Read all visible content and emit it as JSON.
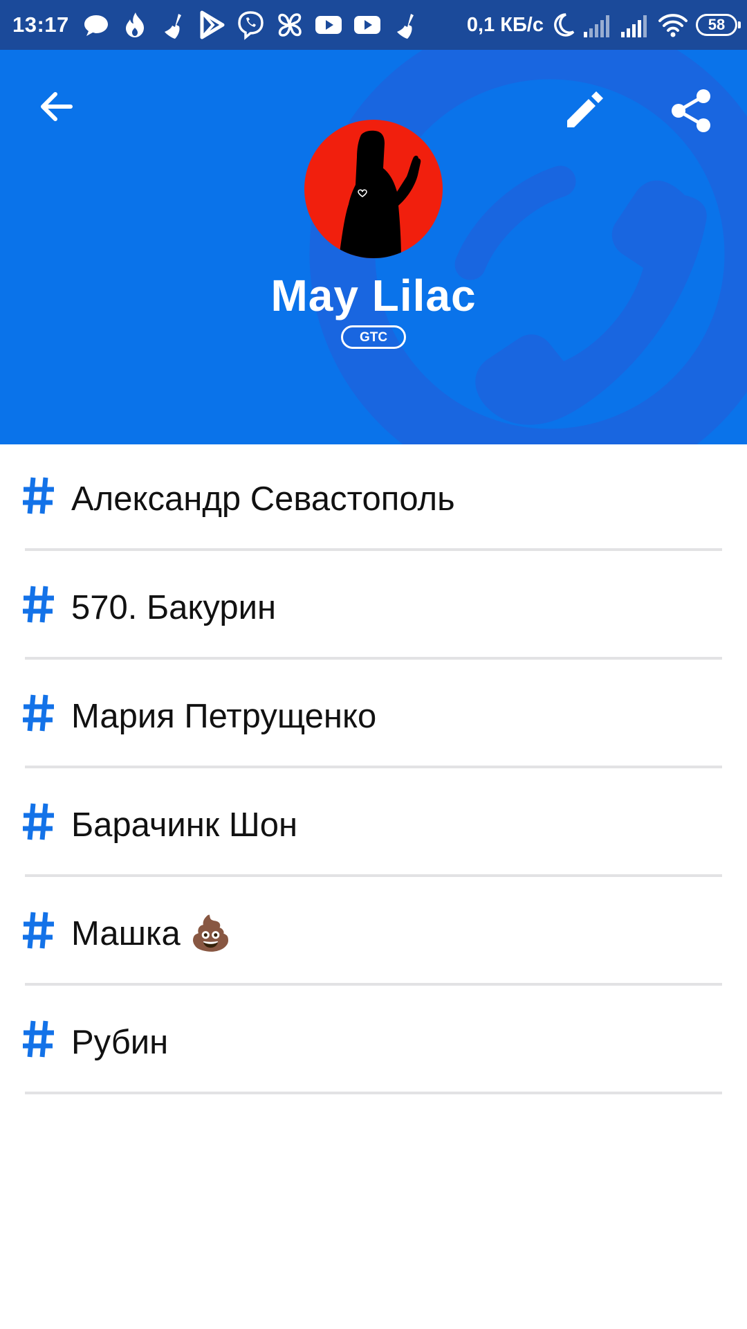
{
  "status_bar": {
    "time": "13:17",
    "notification_icons": [
      "chat-icon",
      "flame-icon",
      "broom-icon",
      "play-store-icon",
      "viber-icon",
      "pinwheel-icon",
      "youtube-icon",
      "youtube-icon",
      "broom-icon"
    ],
    "net_speed": "0,1 КБ/с",
    "battery": "58"
  },
  "header": {
    "contact_name": "May Lilac",
    "badge": "GTC",
    "background_color": "#0a73ea",
    "avatar_color": "#f11f0d"
  },
  "tags": [
    {
      "hash": "#",
      "label": "Александр Севастополь"
    },
    {
      "hash": "#",
      "label": "570. Бакурин"
    },
    {
      "hash": "#",
      "label": "Мария Петрущенко"
    },
    {
      "hash": "#",
      "label": "Барачинк Шон"
    },
    {
      "hash": "#",
      "label": "Машка 💩"
    },
    {
      "hash": "#",
      "label": "Рубин"
    }
  ],
  "colors": {
    "accent": "#0a73ea",
    "status_bar": "#1b4a9a"
  }
}
